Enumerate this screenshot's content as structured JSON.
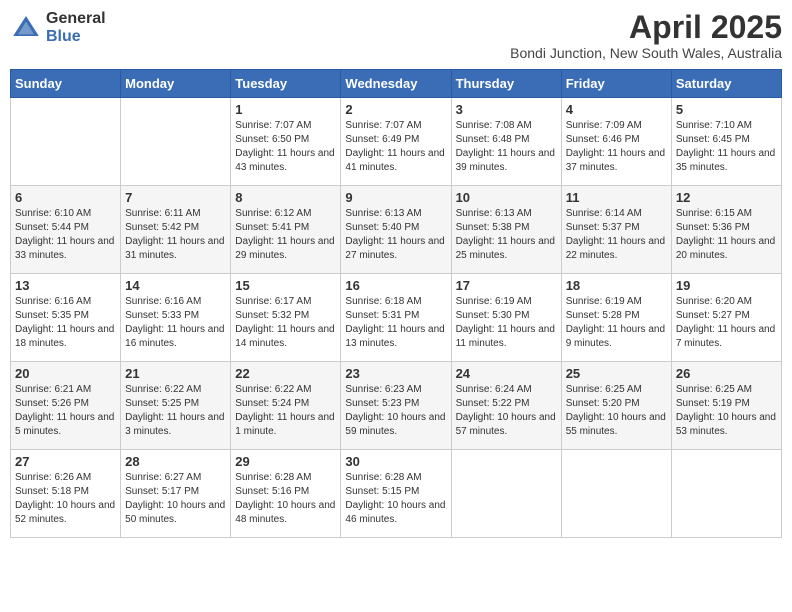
{
  "logo": {
    "general": "General",
    "blue": "Blue"
  },
  "title": "April 2025",
  "subtitle": "Bondi Junction, New South Wales, Australia",
  "days_of_week": [
    "Sunday",
    "Monday",
    "Tuesday",
    "Wednesday",
    "Thursday",
    "Friday",
    "Saturday"
  ],
  "weeks": [
    [
      {
        "num": "",
        "info": ""
      },
      {
        "num": "",
        "info": ""
      },
      {
        "num": "1",
        "info": "Sunrise: 7:07 AM\nSunset: 6:50 PM\nDaylight: 11 hours and 43 minutes."
      },
      {
        "num": "2",
        "info": "Sunrise: 7:07 AM\nSunset: 6:49 PM\nDaylight: 11 hours and 41 minutes."
      },
      {
        "num": "3",
        "info": "Sunrise: 7:08 AM\nSunset: 6:48 PM\nDaylight: 11 hours and 39 minutes."
      },
      {
        "num": "4",
        "info": "Sunrise: 7:09 AM\nSunset: 6:46 PM\nDaylight: 11 hours and 37 minutes."
      },
      {
        "num": "5",
        "info": "Sunrise: 7:10 AM\nSunset: 6:45 PM\nDaylight: 11 hours and 35 minutes."
      }
    ],
    [
      {
        "num": "6",
        "info": "Sunrise: 6:10 AM\nSunset: 5:44 PM\nDaylight: 11 hours and 33 minutes."
      },
      {
        "num": "7",
        "info": "Sunrise: 6:11 AM\nSunset: 5:42 PM\nDaylight: 11 hours and 31 minutes."
      },
      {
        "num": "8",
        "info": "Sunrise: 6:12 AM\nSunset: 5:41 PM\nDaylight: 11 hours and 29 minutes."
      },
      {
        "num": "9",
        "info": "Sunrise: 6:13 AM\nSunset: 5:40 PM\nDaylight: 11 hours and 27 minutes."
      },
      {
        "num": "10",
        "info": "Sunrise: 6:13 AM\nSunset: 5:38 PM\nDaylight: 11 hours and 25 minutes."
      },
      {
        "num": "11",
        "info": "Sunrise: 6:14 AM\nSunset: 5:37 PM\nDaylight: 11 hours and 22 minutes."
      },
      {
        "num": "12",
        "info": "Sunrise: 6:15 AM\nSunset: 5:36 PM\nDaylight: 11 hours and 20 minutes."
      }
    ],
    [
      {
        "num": "13",
        "info": "Sunrise: 6:16 AM\nSunset: 5:35 PM\nDaylight: 11 hours and 18 minutes."
      },
      {
        "num": "14",
        "info": "Sunrise: 6:16 AM\nSunset: 5:33 PM\nDaylight: 11 hours and 16 minutes."
      },
      {
        "num": "15",
        "info": "Sunrise: 6:17 AM\nSunset: 5:32 PM\nDaylight: 11 hours and 14 minutes."
      },
      {
        "num": "16",
        "info": "Sunrise: 6:18 AM\nSunset: 5:31 PM\nDaylight: 11 hours and 13 minutes."
      },
      {
        "num": "17",
        "info": "Sunrise: 6:19 AM\nSunset: 5:30 PM\nDaylight: 11 hours and 11 minutes."
      },
      {
        "num": "18",
        "info": "Sunrise: 6:19 AM\nSunset: 5:28 PM\nDaylight: 11 hours and 9 minutes."
      },
      {
        "num": "19",
        "info": "Sunrise: 6:20 AM\nSunset: 5:27 PM\nDaylight: 11 hours and 7 minutes."
      }
    ],
    [
      {
        "num": "20",
        "info": "Sunrise: 6:21 AM\nSunset: 5:26 PM\nDaylight: 11 hours and 5 minutes."
      },
      {
        "num": "21",
        "info": "Sunrise: 6:22 AM\nSunset: 5:25 PM\nDaylight: 11 hours and 3 minutes."
      },
      {
        "num": "22",
        "info": "Sunrise: 6:22 AM\nSunset: 5:24 PM\nDaylight: 11 hours and 1 minute."
      },
      {
        "num": "23",
        "info": "Sunrise: 6:23 AM\nSunset: 5:23 PM\nDaylight: 10 hours and 59 minutes."
      },
      {
        "num": "24",
        "info": "Sunrise: 6:24 AM\nSunset: 5:22 PM\nDaylight: 10 hours and 57 minutes."
      },
      {
        "num": "25",
        "info": "Sunrise: 6:25 AM\nSunset: 5:20 PM\nDaylight: 10 hours and 55 minutes."
      },
      {
        "num": "26",
        "info": "Sunrise: 6:25 AM\nSunset: 5:19 PM\nDaylight: 10 hours and 53 minutes."
      }
    ],
    [
      {
        "num": "27",
        "info": "Sunrise: 6:26 AM\nSunset: 5:18 PM\nDaylight: 10 hours and 52 minutes."
      },
      {
        "num": "28",
        "info": "Sunrise: 6:27 AM\nSunset: 5:17 PM\nDaylight: 10 hours and 50 minutes."
      },
      {
        "num": "29",
        "info": "Sunrise: 6:28 AM\nSunset: 5:16 PM\nDaylight: 10 hours and 48 minutes."
      },
      {
        "num": "30",
        "info": "Sunrise: 6:28 AM\nSunset: 5:15 PM\nDaylight: 10 hours and 46 minutes."
      },
      {
        "num": "",
        "info": ""
      },
      {
        "num": "",
        "info": ""
      },
      {
        "num": "",
        "info": ""
      }
    ]
  ]
}
